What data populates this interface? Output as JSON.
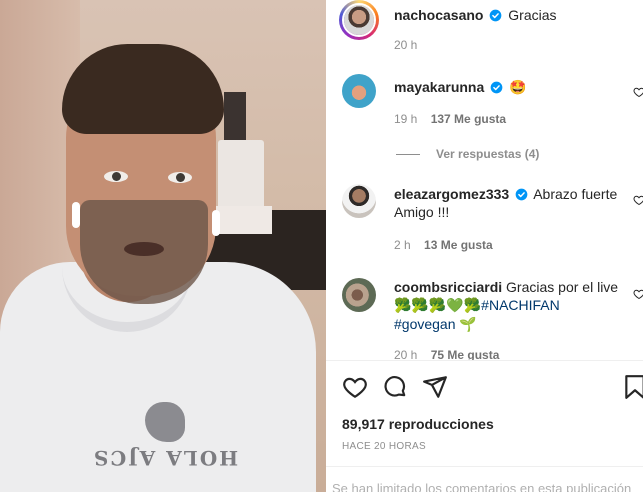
{
  "post": {
    "author": "nachocasano",
    "caption": "Gracias",
    "time": "20 h"
  },
  "comments": [
    {
      "user": "mayakarunna",
      "verified": true,
      "text": "🤩",
      "time": "19 h",
      "likes": "137 Me gusta",
      "replies": "Ver respuestas (4)"
    },
    {
      "user": "eleazargomez333",
      "verified": true,
      "text": "Abrazo fuerte Amigo !!!",
      "time": "2 h",
      "likes": "13 Me gusta"
    },
    {
      "user": "coombsricciardi",
      "verified": false,
      "text": "Gracias por el live",
      "emojis": "🥦🥦🥦💚🥦",
      "hashtag1": "#NACHIFAN",
      "hashtag2": "#govegan",
      "emoji_tail": "🌱",
      "time": "20 h",
      "likes": "75 Me gusta"
    }
  ],
  "stats": {
    "views": "89,917 reproducciones",
    "posted": "HACE 20 HORAS"
  },
  "footer": {
    "limited": "Se han limitado los comentarios en esta publicación"
  },
  "video": {
    "shirt_print": "HOLA AJCS"
  },
  "icons": [
    "verified-badge-icon",
    "heart-icon",
    "comment-icon",
    "share-icon",
    "bookmark-icon"
  ],
  "colors": {
    "verified": "#0095f6",
    "hashtag": "#00376b",
    "muted": "#8e8e8e"
  }
}
